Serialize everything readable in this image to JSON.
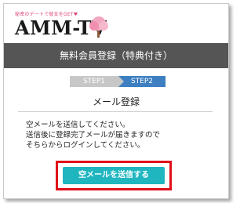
{
  "header": {
    "tagline": "秘密のデートで彼女をGET♥",
    "logo_text": "AMM-TV"
  },
  "banner": {
    "title": "無料会員登録（特典付き）"
  },
  "steps": {
    "step1": "STEP1",
    "step2": "STEP2"
  },
  "section": {
    "title": "メール登録"
  },
  "message": {
    "line1": "空メールを送信してください。",
    "line2": "送信後に登録完了メールが届きますので",
    "line3": "そちらからログインしてください。"
  },
  "button": {
    "label": "空メールを送信する"
  },
  "colors": {
    "banner": "#555555",
    "step_active": "#3d7fc0",
    "step_inactive": "#c7c7c7",
    "button": "#1fb6c0",
    "highlight": "#e0101a",
    "tagline": "#e0457b"
  }
}
